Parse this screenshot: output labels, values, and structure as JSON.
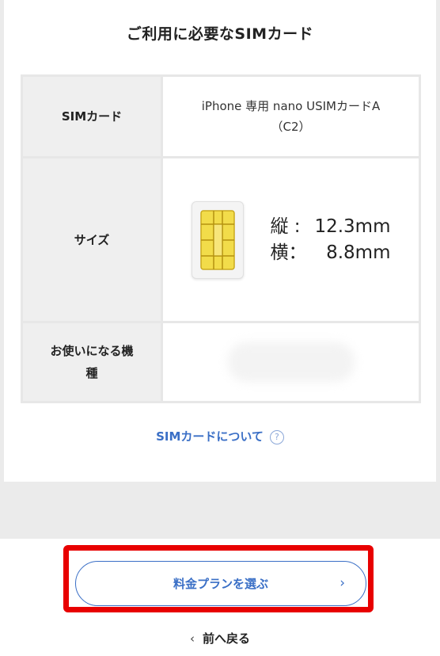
{
  "section": {
    "title": "ご利用に必要なSIMカード"
  },
  "table": {
    "rows": [
      {
        "label": "SIMカード",
        "value_line1": "iPhone 専用 nano USIMカードA",
        "value_line2": "（C2）"
      },
      {
        "label": "サイズ",
        "dim_height_label": "縦 :",
        "dim_height_value": "12.3mm",
        "dim_width_label": "横：",
        "dim_width_value": "8.8mm"
      },
      {
        "label_line1": "お使いになる機",
        "label_line2": "種",
        "value": ""
      }
    ]
  },
  "links": {
    "sim_about": "SIMカードについて",
    "help_glyph": "?"
  },
  "buttons": {
    "choose_plan": "料金プランを選ぶ",
    "choose_plan_chevron": "›",
    "back": "前へ戻る",
    "back_chevron": "‹"
  },
  "icons": {
    "sim": "sim-card-icon",
    "help": "help-circle-icon"
  },
  "colors": {
    "accent": "#3a6fc6",
    "highlight": "#e80000",
    "chip_gold": "#f2dc4a"
  }
}
